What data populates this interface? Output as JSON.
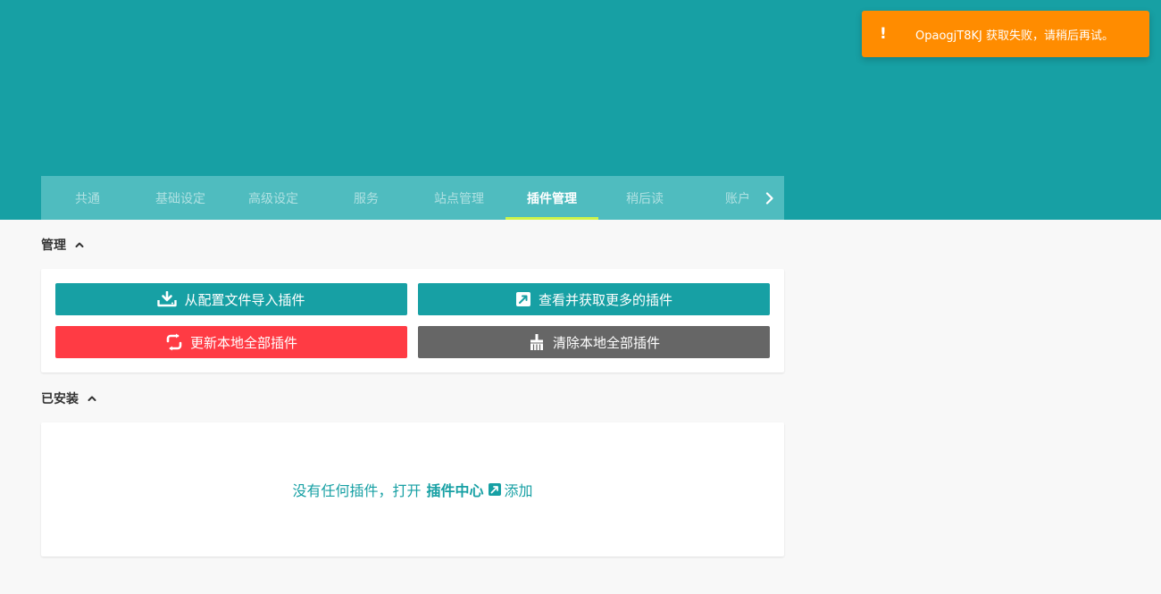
{
  "tabs": {
    "items": [
      {
        "label": "共通"
      },
      {
        "label": "基础设定"
      },
      {
        "label": "高级设定"
      },
      {
        "label": "服务"
      },
      {
        "label": "站点管理"
      },
      {
        "label": "插件管理",
        "active": true
      },
      {
        "label": "稍后读"
      },
      {
        "label": "账户"
      }
    ],
    "next_icon": "chevron-right-icon"
  },
  "manage": {
    "title": "管理",
    "buttons": {
      "import": {
        "label": "从配置文件导入插件",
        "icon": "download-tray-icon"
      },
      "more": {
        "label": "查看并获取更多的插件",
        "icon": "external-link-icon"
      },
      "update": {
        "label": "更新本地全部插件",
        "icon": "refresh-icon"
      },
      "clear": {
        "label": "清除本地全部插件",
        "icon": "broom-icon"
      }
    }
  },
  "installed": {
    "title": "已安装",
    "empty_prefix": "没有任何插件，打开",
    "link_label": "插件中心",
    "empty_suffix": "添加"
  },
  "toast": {
    "icon": "!",
    "message": "OpaogjT8KJ 获取失败，请稍后再试。"
  },
  "colors": {
    "brand": "#17a0a4",
    "tabs_bg": "#4fbcbf",
    "tab_indicator": "#ccf44a",
    "danger": "#ff3b44",
    "neutral": "#666666",
    "warning": "#ff8c00"
  }
}
